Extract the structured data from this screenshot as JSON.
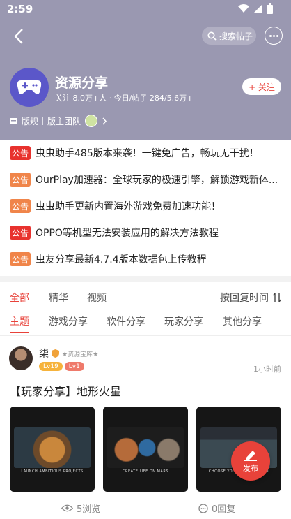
{
  "status_bar": {
    "time": "2:59"
  },
  "header": {
    "search_label": "搜索帖子",
    "forum_name": "资源分享",
    "stats": "关注 8.0万+人 · 今日/帖子 284/5.6万+",
    "follow_label": "+ 关注",
    "rules_label": "版规",
    "team_label": "版主团队"
  },
  "notices": [
    {
      "badge": "公告",
      "color": "red",
      "text": "虫虫助手485版本来袭！一键免广告，畅玩无干扰！"
    },
    {
      "badge": "公告",
      "color": "orange",
      "text": "OurPlay加速器：全球玩家的极速引擎，解锁游戏新体..."
    },
    {
      "badge": "公告",
      "color": "orange",
      "text": "虫虫助手更新内置海外游戏免费加速功能！"
    },
    {
      "badge": "公告",
      "color": "red",
      "text": "OPPO等机型无法安装应用的解决方法教程"
    },
    {
      "badge": "公告",
      "color": "orange",
      "text": "虫友分享最新4.7.4版本数据包上传教程"
    }
  ],
  "tabs": [
    "全部",
    "精华",
    "视频"
  ],
  "sort_label": "按回复时间",
  "categories": [
    "主题",
    "游戏分享",
    "软件分享",
    "玩家分享",
    "其他分享"
  ],
  "post": {
    "author": "柒",
    "author_title": "★资源宝库★",
    "badges": [
      "Lv19",
      "Lv1"
    ],
    "time": "1小时前",
    "title": "【玩家分享】地形火星",
    "thumb_captions": [
      "LAUNCH AMBITIOUS PROJECTS",
      "CREATE LIFE ON MARS",
      "CHOOSE YOUR CORPORATION"
    ],
    "views": "5浏览",
    "replies": "0回复"
  },
  "fab_label": "发布",
  "colors": {
    "header_bg": "#9a98b1",
    "accent": "#e8423a",
    "notice_red": "#e8322e",
    "notice_orange": "#f0854a"
  }
}
